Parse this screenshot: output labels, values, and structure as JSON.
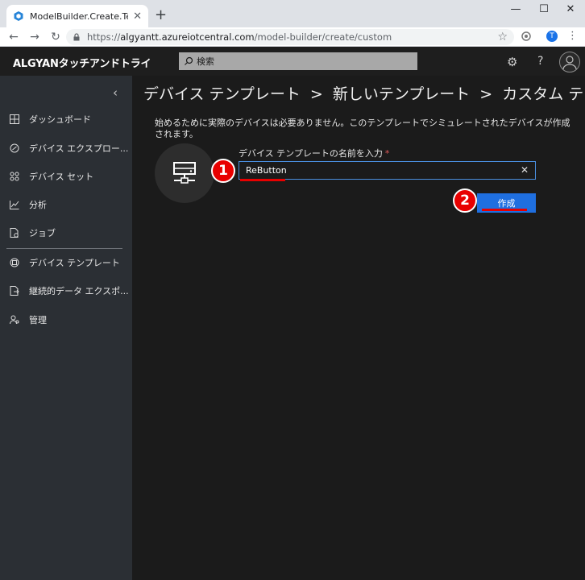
{
  "browser": {
    "tab_title": "ModelBuilder.Create.TemplatesTi",
    "url_scheme": "https://",
    "url_host": "algyantt.azureiotcentral.com",
    "url_path": "/model-builder/create/custom",
    "profile_initial": "T"
  },
  "app": {
    "brand": "ALGYANタッチアンドトライ",
    "search_placeholder": "検索"
  },
  "sidebar": {
    "items": [
      {
        "label": "ダッシュボード",
        "icon": "dashboard-icon"
      },
      {
        "label": "デバイス エクスプロー...",
        "icon": "device-explorer-icon"
      },
      {
        "label": "デバイス セット",
        "icon": "device-sets-icon"
      },
      {
        "label": "分析",
        "icon": "analytics-icon"
      },
      {
        "label": "ジョブ",
        "icon": "jobs-icon"
      },
      {
        "label": "デバイス テンプレート",
        "icon": "device-templates-icon"
      },
      {
        "label": "継続的データ エクスポ...",
        "icon": "data-export-icon"
      },
      {
        "label": "管理",
        "icon": "administration-icon"
      }
    ]
  },
  "breadcrumb": {
    "part1": "デバイス テンプレート",
    "sep": ">",
    "part2": "新しいテンプレート",
    "part3": "カスタム テン"
  },
  "form": {
    "intro": "始めるために実際のデバイスは必要ありません。このテンプレートでシミュレートされたデバイスが作成されます。",
    "name_label": "デバイス テンプレートの名前を入力",
    "required_mark": "*",
    "name_value": "ReButton",
    "create_label": "作成"
  },
  "annotations": {
    "step1": "1",
    "step2": "2"
  },
  "colors": {
    "accent": "#1f6fe0",
    "annotation": "#e80000",
    "sidebar_bg": "#2b2f34",
    "main_bg": "#1b1b1b"
  }
}
